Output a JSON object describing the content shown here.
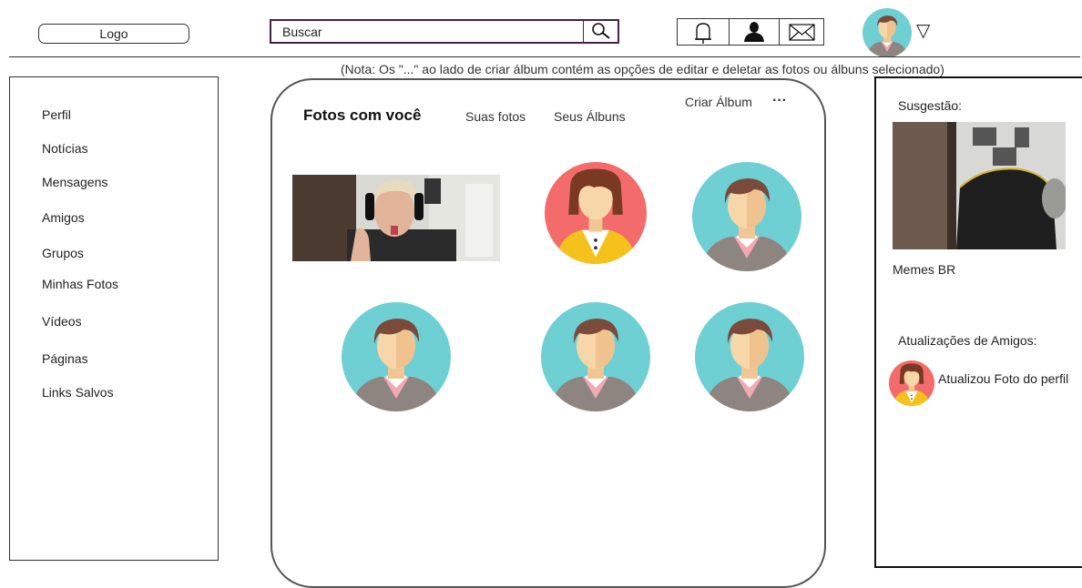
{
  "header": {
    "logo_label": "Logo",
    "search_placeholder": "Buscar",
    "icons": [
      "bell-icon",
      "user-icon",
      "mail-icon"
    ],
    "dropdown_symbol": "▽"
  },
  "note": "(Nota: Os \"...\" ao lado de criar álbum contém as opções de editar e deletar as fotos ou álbuns selecionado)",
  "sidebar": {
    "items": [
      {
        "label": "Perfil"
      },
      {
        "label": "Notícias"
      },
      {
        "label": "Mensagens"
      },
      {
        "label": "Amigos"
      },
      {
        "label": "Grupos"
      },
      {
        "label": "Minhas Fotos"
      },
      {
        "label": "Vídeos"
      },
      {
        "label": "Páginas"
      },
      {
        "label": "Links Salvos"
      }
    ]
  },
  "main": {
    "tabs": [
      {
        "label": "Fotos com você"
      },
      {
        "label": "Suas fotos"
      },
      {
        "label": "Seus Álbuns"
      }
    ],
    "create_album_label": "Criar Álbum",
    "more_label": "···"
  },
  "right": {
    "suggestion_title": "Susgestão:",
    "suggestion_name": "Memes BR",
    "updates_title": "Atualizações de Amigos:",
    "update_text": "Atualizou Foto do perfil"
  },
  "colors": {
    "avatar_teal": "#6fd0d4",
    "avatar_coral": "#f36b6b",
    "hair": "#7a4a3a",
    "search_border": "#4a1f4a"
  }
}
